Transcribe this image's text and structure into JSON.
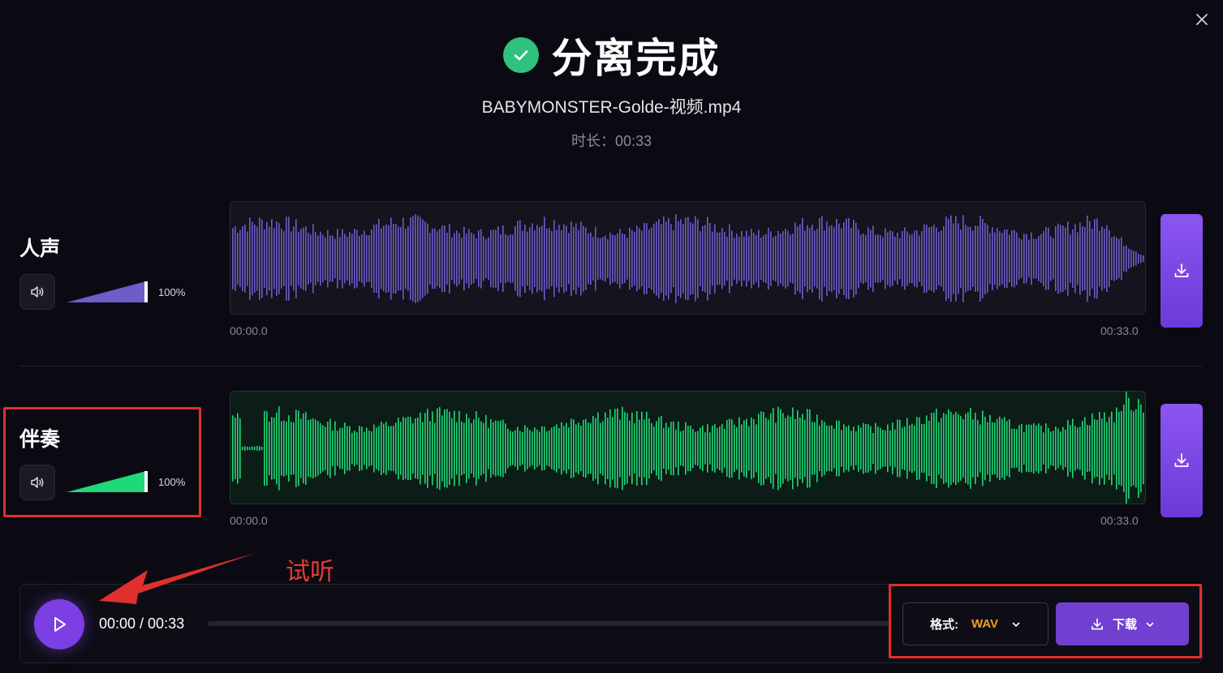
{
  "header": {
    "title": "分离完成",
    "filename": "BABYMONSTER-Golde-视频.mp4",
    "duration": "时长：00:33"
  },
  "tracks": [
    {
      "name": "人声",
      "volume_label": "100%",
      "volume": 1.0,
      "start": "00:00.0",
      "end": "00:33.0",
      "color": "#6e5cc8"
    },
    {
      "name": "伴奏",
      "volume_label": "100%",
      "volume": 1.0,
      "start": "00:00.0",
      "end": "00:33.0",
      "color": "#1fd87a"
    }
  ],
  "annotation": {
    "text": "试听",
    "color": "#e0302c"
  },
  "player": {
    "time": "00:00 / 00:33",
    "progress": 0,
    "format_label": "格式:",
    "format_value": "WAV",
    "download_label": "下载"
  },
  "colors": {
    "accent": "#7b3fe4",
    "success": "#2ec27e",
    "format_value": "#f0a020"
  },
  "icons": [
    "close-icon",
    "check-icon",
    "speaker-icon",
    "download-icon",
    "play-icon",
    "chevron-down-icon"
  ]
}
